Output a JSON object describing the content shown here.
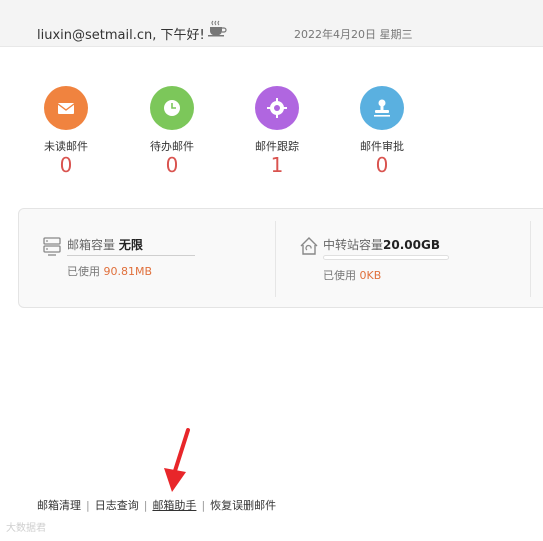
{
  "header": {
    "greeting": "liuxin@setmail.cn, 下午好!",
    "date": "2022年4月20日 星期三"
  },
  "stats": [
    {
      "label": "未读邮件",
      "count": "0",
      "color": "#f0833f",
      "icon": "mail-icon"
    },
    {
      "label": "待办邮件",
      "count": "0",
      "color": "#7cc75a",
      "icon": "clock-icon"
    },
    {
      "label": "邮件跟踪",
      "count": "1",
      "color": "#b066e0",
      "icon": "target-icon"
    },
    {
      "label": "邮件审批",
      "count": "0",
      "color": "#5ab0e0",
      "icon": "stamp-icon"
    }
  ],
  "storage": {
    "mailbox": {
      "title": "邮箱容量",
      "capacity": "无限",
      "used_label": "已使用",
      "used_value": "90.81MB"
    },
    "transfer": {
      "title": "中转站容量",
      "capacity": "20.00GB",
      "used_label": "已使用",
      "used_value": "0KB",
      "used_fraction": 0
    }
  },
  "footer": {
    "links": [
      "邮箱清理",
      "日志查询",
      "邮箱助手",
      "恢复误删邮件"
    ],
    "active_index": 2
  },
  "annotation": {
    "arrow_color": "#e8262a"
  },
  "watermark": "大数据君"
}
